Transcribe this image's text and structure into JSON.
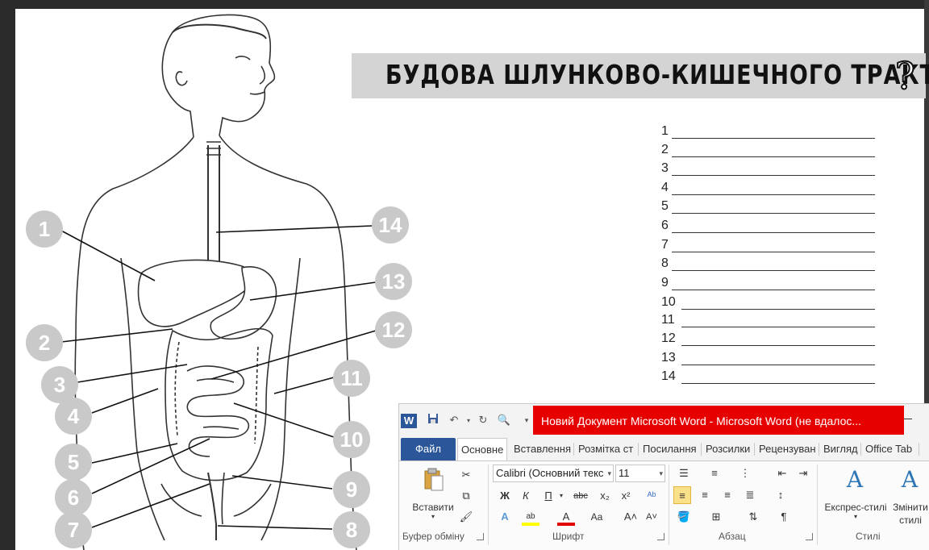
{
  "worksheet": {
    "title": "БУДОВА ШЛУНКОВО-КИШЕЧНОГО ТРАКТУ",
    "title_symbol": "?",
    "callouts": [
      "1",
      "2",
      "3",
      "4",
      "5",
      "6",
      "7",
      "8",
      "9",
      "10",
      "11",
      "12",
      "13",
      "14"
    ],
    "answer_numbers": [
      "1",
      "2",
      "3",
      "4",
      "5",
      "6",
      "7",
      "8",
      "9",
      "10",
      "11",
      "12",
      "13",
      "14"
    ]
  },
  "word": {
    "window_title": "Новий Документ Microsoft Word - Microsoft Word (не вдалос...",
    "tabs": [
      {
        "label": "Файл"
      },
      {
        "label": "Основне"
      },
      {
        "label": "Вставлення"
      },
      {
        "label": "Розмітка ст"
      },
      {
        "label": "Посилання"
      },
      {
        "label": "Розсилки"
      },
      {
        "label": "Рецензуван"
      },
      {
        "label": "Вигляд"
      },
      {
        "label": "Office Tab"
      }
    ],
    "clipboard": {
      "paste_label": "Вставити",
      "group_label": "Буфер обміну"
    },
    "font": {
      "name": "Calibri (Основний текс",
      "size": "11",
      "group_label": "Шрифт"
    },
    "paragraph": {
      "group_label": "Абзац"
    },
    "styles": {
      "express_label": "Експрес-стилі",
      "change_label_1": "Змінити",
      "change_label_2": "стилі",
      "group_label": "Стилі"
    },
    "colors": {
      "accent": "#2b579a",
      "title_bar": "#e60000",
      "highlight": "#fbe08a"
    }
  }
}
